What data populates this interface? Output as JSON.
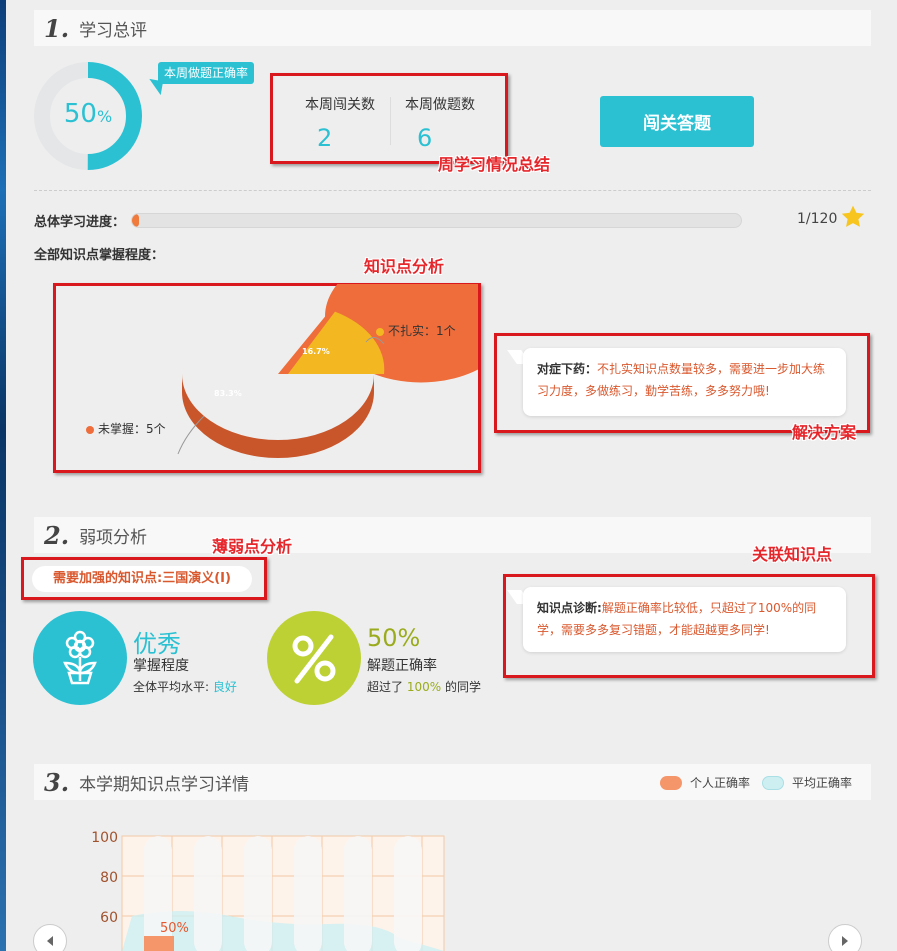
{
  "section1": {
    "num": "1.",
    "title": "学习总评",
    "ring_percent": "50",
    "ring_unit": "%",
    "ring_fraction": 0.5,
    "bubble": "本周做题正确率",
    "stat1_label": "本周闯关数",
    "stat1_value": "2",
    "stat2_label": "本周做题数",
    "stat2_value": "6",
    "button": "闯关答题",
    "progress_label": "总体学习进度：",
    "progress_fraction": 0.0083,
    "progress_count": "1/120",
    "mastery_label": "全部知识点掌握程度："
  },
  "pie": {
    "chart_data": {
      "type": "pie",
      "slices": [
        {
          "name": "未掌握",
          "value": 5,
          "percent": 83.3,
          "color": "#ee6d3a"
        },
        {
          "name": "不扎实",
          "value": 1,
          "percent": 16.7,
          "color": "#f3b722"
        }
      ]
    },
    "label_small": "不扎实：1个",
    "label_big": "未掌握：5个",
    "pct_small": "16.7%",
    "pct_big": "83.3%"
  },
  "solution": {
    "key": "对症下药：",
    "text": "不扎实知识点数量较多，需要进一步加大练习力度，多做练习，勤学苦练，多多努力哦!"
  },
  "annotations": {
    "weekly": "周学习情况总结",
    "knowledge": "知识点分析",
    "solution": "解决方案",
    "weak": "薄弱点分析",
    "related": "关联知识点"
  },
  "section2": {
    "num": "2.",
    "title": "弱项分析",
    "weak_point": "需要加强的知识点:三国演义(I)",
    "mastery_value": "优秀",
    "mastery_label": "掌握程度",
    "avg_label": "全体平均水平:",
    "avg_value": "良好",
    "accuracy_value": "50%",
    "accuracy_label": "解题正确率",
    "beat_prefix": "超过了",
    "beat_value": "100%",
    "beat_suffix": "的同学",
    "diag_key": "知识点诊断:",
    "diag_text": "解题正确率比较低，只超过了100%的同学，需要多多复习错题，才能超越更多同学!"
  },
  "section3": {
    "num": "3.",
    "title": "本学期知识点学习详情",
    "legend_personal": "个人正确率",
    "legend_average": "平均正确率",
    "colors": {
      "personal": "#f5956a",
      "average": "#cdeff2"
    },
    "chart_data": {
      "type": "bar",
      "yticks": [
        "100",
        "80",
        "60"
      ],
      "ylim": [
        0,
        100
      ],
      "series": [
        {
          "name": "个人正确率",
          "values": [
            50
          ]
        }
      ],
      "data_label": "50%"
    }
  }
}
